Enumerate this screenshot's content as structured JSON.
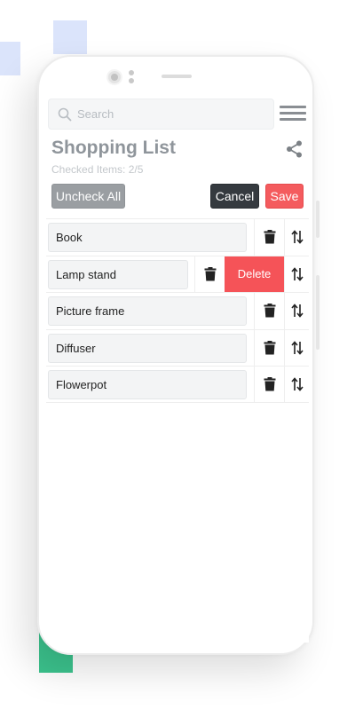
{
  "search": {
    "placeholder": "Search"
  },
  "header": {
    "title": "Shopping List",
    "checked_summary": "Checked Items: 2/5"
  },
  "toolbar": {
    "uncheck_all_label": "Uncheck All",
    "cancel_label": "Cancel",
    "save_label": "Save"
  },
  "items": [
    {
      "label": "Book"
    },
    {
      "label": "Lamp stand"
    },
    {
      "label": "Picture frame"
    },
    {
      "label": "Diffuser"
    },
    {
      "label": "Flowerpot"
    }
  ],
  "swipe": {
    "delete_label": "Delete"
  },
  "colors": {
    "save": "#f45b5e",
    "cancel": "#353a3f",
    "uncheck": "#9a9ea2",
    "delete": "#f55358",
    "deco_blue": "#dbe4fb",
    "deco_green": "#3cc48e"
  },
  "icons": [
    "search-icon",
    "menu-icon",
    "share-icon",
    "trash-icon",
    "sort-arrows-icon"
  ]
}
